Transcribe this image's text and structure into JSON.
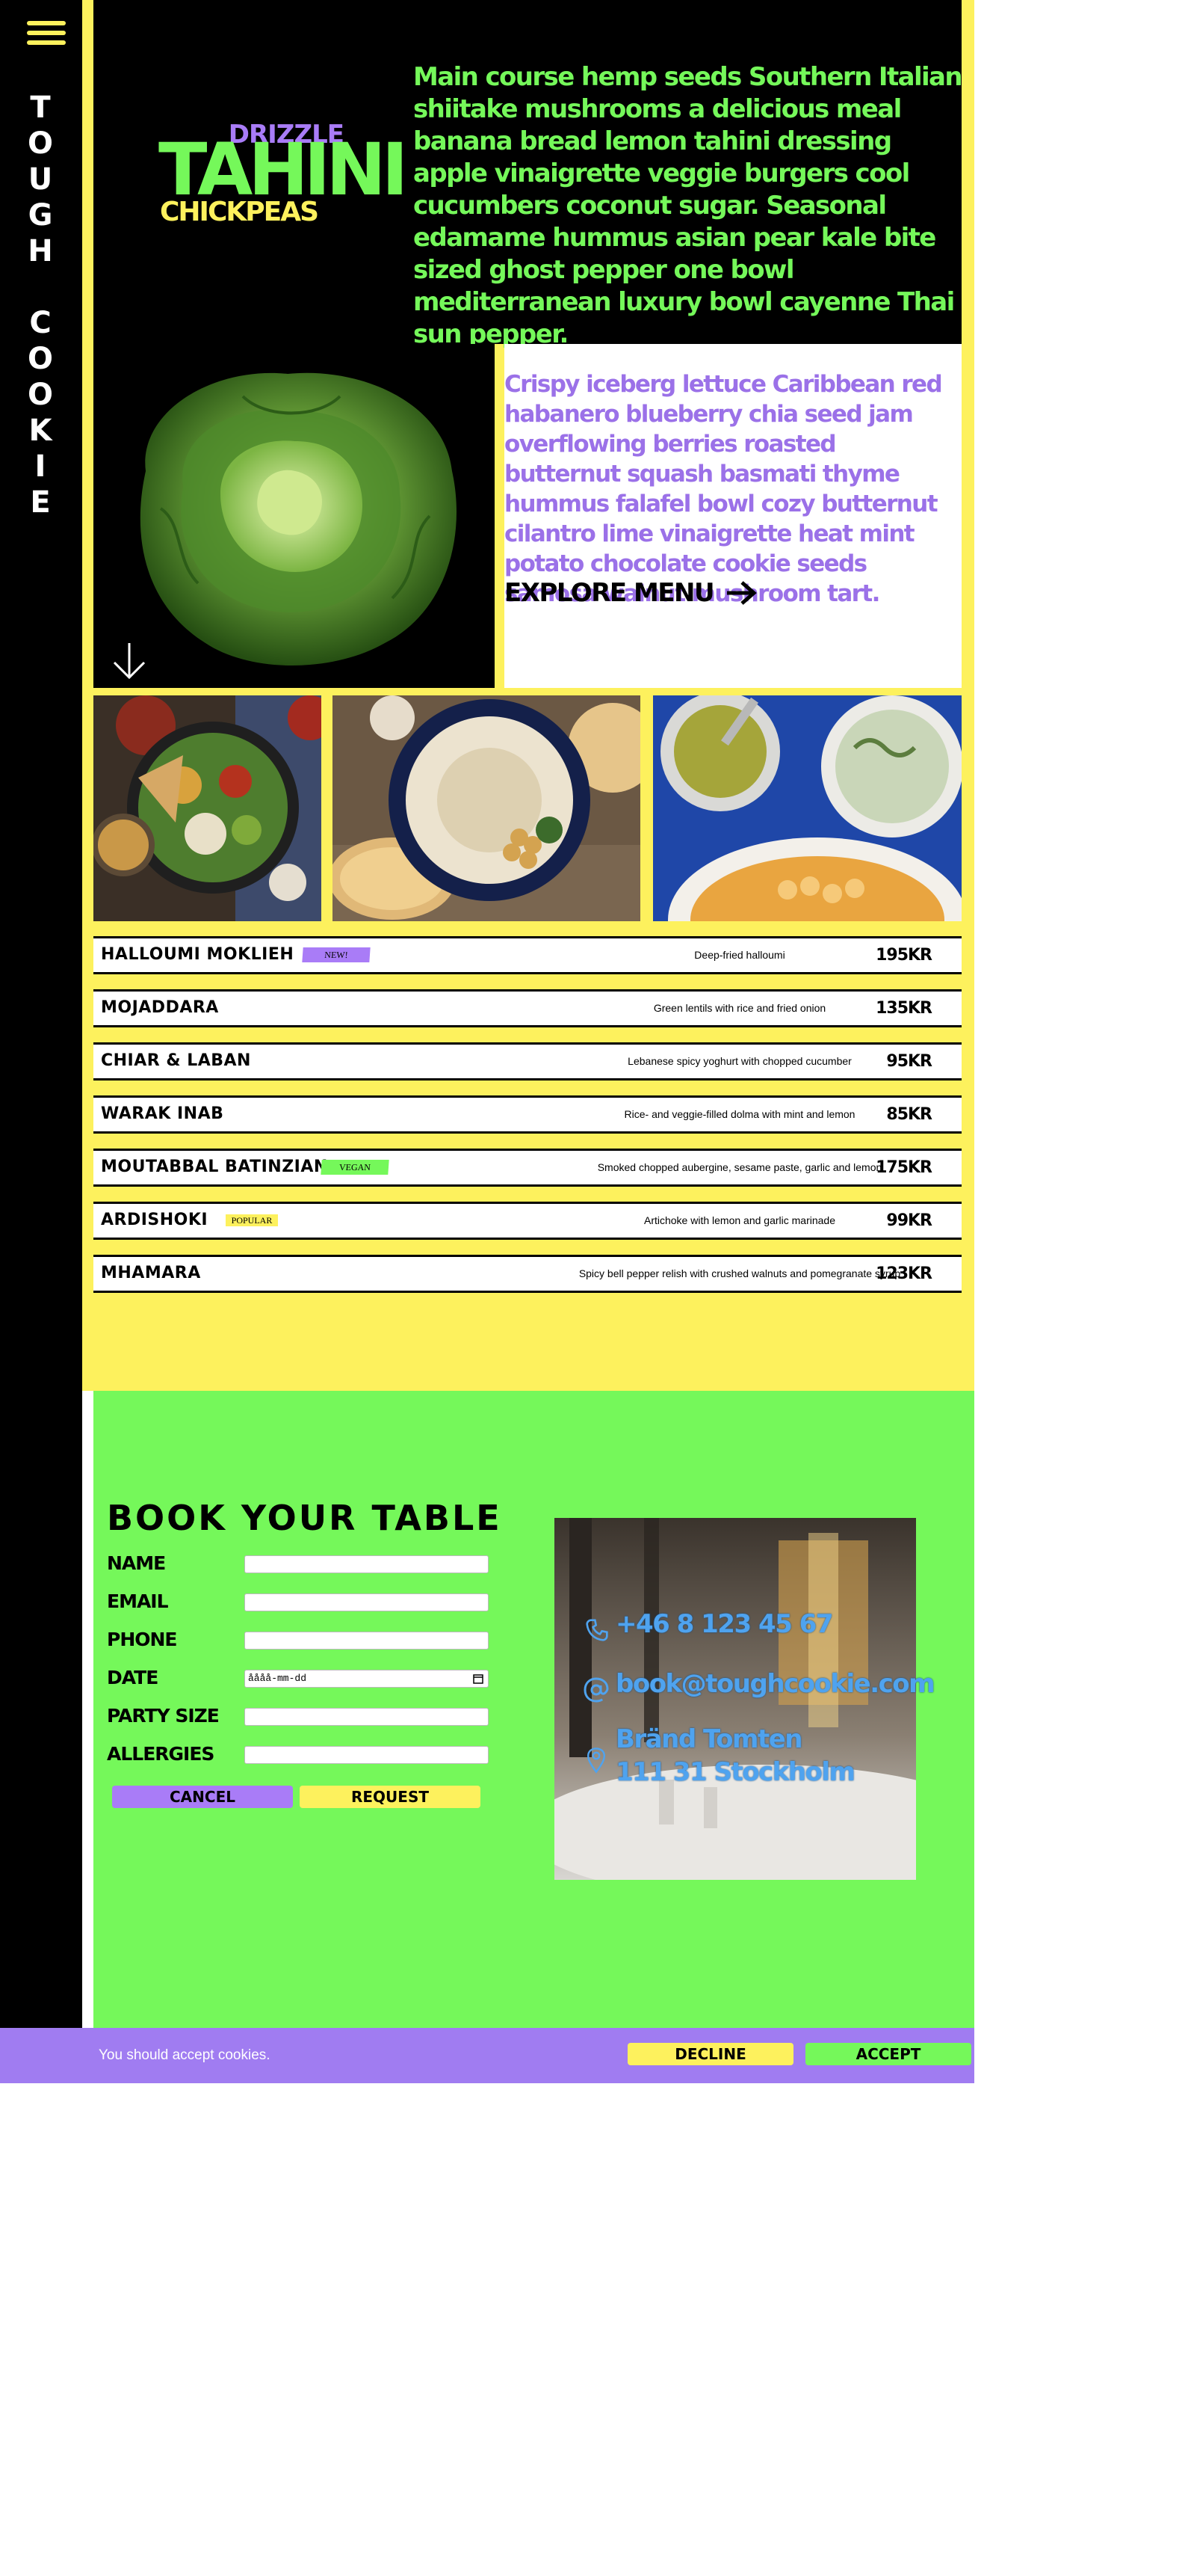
{
  "brand": {
    "letters": [
      "T",
      "O",
      "U",
      "G",
      "H",
      "",
      "C",
      "O",
      "O",
      "K",
      "I",
      "E"
    ],
    "logo_small_top": "DRIZZLE",
    "logo_main": "TAHINI",
    "logo_small_bottom": "CHICKPEAS"
  },
  "hero": {
    "text": "Main course hemp seeds Southern Italian shiitake mushrooms a delicious meal banana bread lemon tahini dressing apple vinaigrette veggie burgers cool cucumbers coconut sugar. Seasonal edamame hummus asian pear kale bite sized ghost pepper one bowl mediterranean luxury bowl cayenne Thai sun pepper.",
    "card_text": "Crispy iceberg lettuce Caribbean red habanero blueberry chia seed jam overflowing berries roasted butternut squash basmati thyme hummus falafel bowl cozy butternut cilantro lime vinaigrette heat mint potato chocolate cookie seeds samosa walnut mushroom tart.",
    "explore_label": "EXPLORE MENU"
  },
  "menu": [
    {
      "name": "HALLOUMI MOKLIEH",
      "badge": "NEW!",
      "badge_color": "#a97cf7",
      "description": "Deep-fried halloumi",
      "price": "195KR"
    },
    {
      "name": "MOJADDARA",
      "badge": "",
      "badge_color": "",
      "description": "Green lentils with rice and fried onion",
      "price": "135KR"
    },
    {
      "name": "CHIAR & LABAN",
      "badge": "",
      "badge_color": "",
      "description": "Lebanese spicy yoghurt with chopped cucumber",
      "price": "95KR"
    },
    {
      "name": "WARAK INAB",
      "badge": "",
      "badge_color": "",
      "description": "Rice- and veggie-filled dolma with mint and lemon",
      "price": "85KR"
    },
    {
      "name": "MOUTABBAL BATINZIAN",
      "badge": "VEGAN",
      "badge_color": "#75f85a",
      "description": "Smoked chopped aubergine, sesame paste, garlic and lemon",
      "price": "175KR"
    },
    {
      "name": "ARDISHOKI",
      "badge": "POPULAR",
      "badge_color": "#fdf15d",
      "description": "Artichoke with lemon and garlic marinade",
      "price": "99KR"
    },
    {
      "name": "MHAMARA",
      "badge": "",
      "badge_color": "",
      "description": "Spicy bell pepper relish with crushed walnuts and pomegranate syrup",
      "price": "123KR"
    }
  ],
  "booking": {
    "title": "BOOK YOUR TABLE",
    "fields": {
      "name": "NAME",
      "email": "EMAIL",
      "phone": "PHONE",
      "date": "DATE",
      "party_size": "PARTY SIZE",
      "allergies": "ALLERGIES"
    },
    "date_placeholder": "åååå-mm-dd",
    "cancel_label": "CANCEL",
    "request_label": "REQUEST"
  },
  "contact": {
    "phone": "+46 8 123 45 67",
    "email": "book@toughcookie.com",
    "address_line1": "Bränd Tomten",
    "address_line2": "111 31 Stockholm"
  },
  "cookie": {
    "text": "You should accept cookies.",
    "decline_label": "DECLINE",
    "accept_label": "ACCEPT"
  },
  "colors": {
    "yellow": "#fdf15d",
    "green": "#75f85a",
    "purple": "#a97cf7",
    "black": "#000000",
    "contact_blue": "#4fa3ef"
  }
}
